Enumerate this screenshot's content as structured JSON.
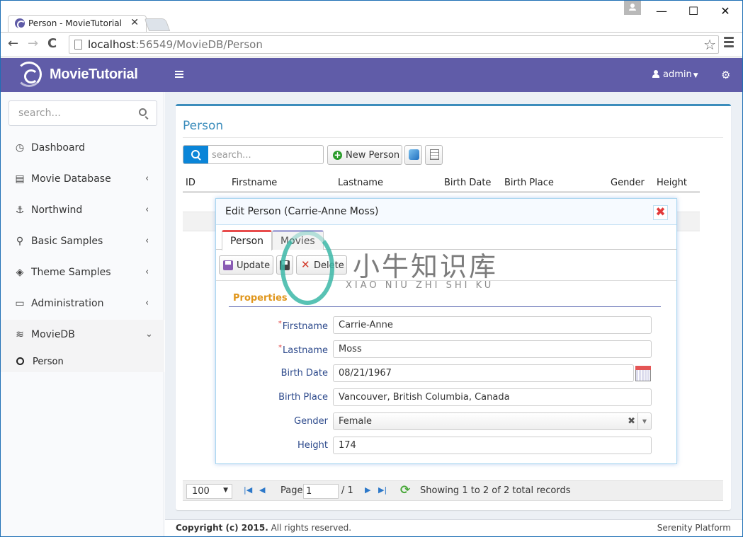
{
  "browser": {
    "tab_title": "Person - MovieTutorial",
    "tab_close": "✕",
    "url_host": "localhost",
    "url_rest": ":56549/MovieDB/Person",
    "window_controls": {
      "minimize": "—",
      "maximize": "☐",
      "close": "✕"
    },
    "nav": {
      "back": "←",
      "forward": "→",
      "reload": "C"
    },
    "star": "☆"
  },
  "header": {
    "app_name": "MovieTutorial",
    "user": "admin",
    "caret": "▼",
    "settings_icon": "⚙"
  },
  "sidebar": {
    "search_placeholder": "search...",
    "items": [
      {
        "label": "Dashboard",
        "icon": "◷",
        "has_arrow": false
      },
      {
        "label": "Movie Database",
        "icon": "▤",
        "arrow": "‹"
      },
      {
        "label": "Northwind",
        "icon": "⚓",
        "arrow": "‹"
      },
      {
        "label": "Basic Samples",
        "icon": "⚲",
        "arrow": "‹"
      },
      {
        "label": "Theme Samples",
        "icon": "◈",
        "arrow": "‹"
      },
      {
        "label": "Administration",
        "icon": "▭",
        "arrow": "‹"
      },
      {
        "label": "MovieDB",
        "icon": "≋",
        "arrow": "⌄",
        "expanded": true
      }
    ],
    "sub_items": [
      {
        "label": "Person",
        "active": true
      }
    ]
  },
  "page": {
    "title": "Person",
    "search_placeholder": "search...",
    "new_button": "New Person",
    "plus_icon": "+",
    "columns": [
      "ID",
      "Firstname",
      "Lastname",
      "Birth Date",
      "Birth Place",
      "Gender",
      "Height"
    ]
  },
  "pager": {
    "page_size": "100",
    "caret": "▼",
    "first": "|◀",
    "prev": "◀",
    "page_label": "Page",
    "page_value": "1",
    "of_label": "/ 1",
    "next": "▶",
    "last": "▶|",
    "reload": "⟳",
    "status": "Showing 1 to 2 of 2 total records"
  },
  "footer": {
    "copyright_bold": "Copyright (c) 2015.",
    "copyright_rest": " All rights reserved.",
    "brand": "Serenity Platform"
  },
  "dialog": {
    "title": "Edit Person (Carrie-Anne Moss)",
    "close": "✖",
    "tabs": [
      {
        "label": "Person",
        "active": true
      },
      {
        "label": "Movies",
        "active": false
      }
    ],
    "toolbar": {
      "update": "Update",
      "delete": "Delete",
      "delete_icon": "✕"
    },
    "section_title": "Properties",
    "required_mark": "*",
    "fields": [
      {
        "label": "Firstname",
        "value": "Carrie-Anne",
        "required": true
      },
      {
        "label": "Lastname",
        "value": "Moss",
        "required": true
      },
      {
        "label": "Birth Date",
        "value": "08/21/1967",
        "required": false
      },
      {
        "label": "Birth Place",
        "value": "Vancouver, British Columbia, Canada",
        "required": false
      },
      {
        "label": "Gender",
        "value": "Female",
        "required": false,
        "clear": "✖",
        "dropdown": "▼"
      },
      {
        "label": "Height",
        "value": "174",
        "required": false
      }
    ]
  },
  "watermark": {
    "text": "小牛知识库",
    "sub": "XIAO NIU ZHI SHI KU"
  }
}
